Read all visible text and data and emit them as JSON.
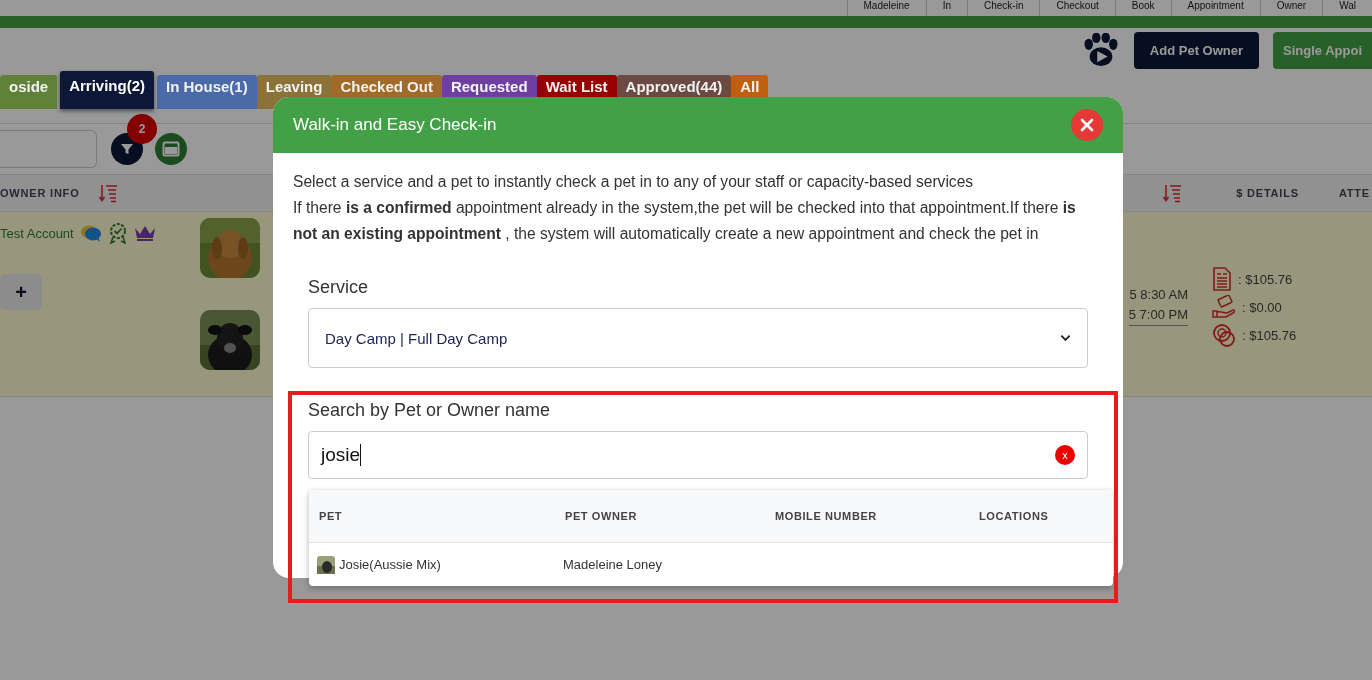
{
  "top_header": {
    "cells": [
      "Madeleine",
      "In",
      "Check-in",
      "Checkout",
      "Book",
      "Appointment",
      "Owner",
      "Wal"
    ]
  },
  "actions": {
    "buttons": [
      {
        "label": "Add Pet Owner",
        "kind": "dark"
      },
      {
        "label": "Single Appoi",
        "kind": "green"
      }
    ]
  },
  "tabs": [
    {
      "label": "oside",
      "color": "#5f8238",
      "selected": false
    },
    {
      "label": "Arriving(2)",
      "color": "#0d1838",
      "selected": true
    },
    {
      "label": "In House(1)",
      "color": "#4a6aa8",
      "selected": false
    },
    {
      "label": "Leaving",
      "color": "#8a7238",
      "selected": false
    },
    {
      "label": "Checked Out",
      "color": "#a06a28",
      "selected": false
    },
    {
      "label": "Requested",
      "color": "#6e3fa0",
      "selected": false
    },
    {
      "label": "Wait List",
      "color": "#980000",
      "selected": false
    },
    {
      "label": "Approved(44)",
      "color": "#6a4a42",
      "selected": false
    },
    {
      "label": "All",
      "color": "#c0600e",
      "selected": false
    }
  ],
  "filter": {
    "badge": "2"
  },
  "table": {
    "columns": [
      "OWNER INFO",
      "$ DETAILS",
      "ATTE"
    ],
    "row": {
      "owner": "Test Account",
      "add_button": "+",
      "times": [
        "5 8:30 AM",
        "5 7:00 PM"
      ],
      "amounts": [
        ": $105.76",
        ": $0.00",
        ": $105.76"
      ]
    }
  },
  "modal": {
    "title": "Walk-in and Easy Check-in",
    "intro": "Select a service and a pet to instantly check a pet in to any of your staff or capacity-based services",
    "notice": "If there **is a confirmed** appointment already in the system,the pet will be checked into that appointment.If there **is not an existing appointment** , the system will automatically create a new appointment and check the pet in",
    "service": {
      "label": "Service",
      "value": "Day Camp | Full Day Camp"
    },
    "search": {
      "label": "Search by Pet or Owner name",
      "value": "josie",
      "clear": "x"
    },
    "results": {
      "columns": [
        "PET",
        "PET OWNER",
        "MOBILE NUMBER",
        "LOCATIONS"
      ],
      "rows": [
        {
          "pet": "Josie(Aussie Mix)",
          "owner": "Madeleine Loney"
        }
      ]
    }
  }
}
